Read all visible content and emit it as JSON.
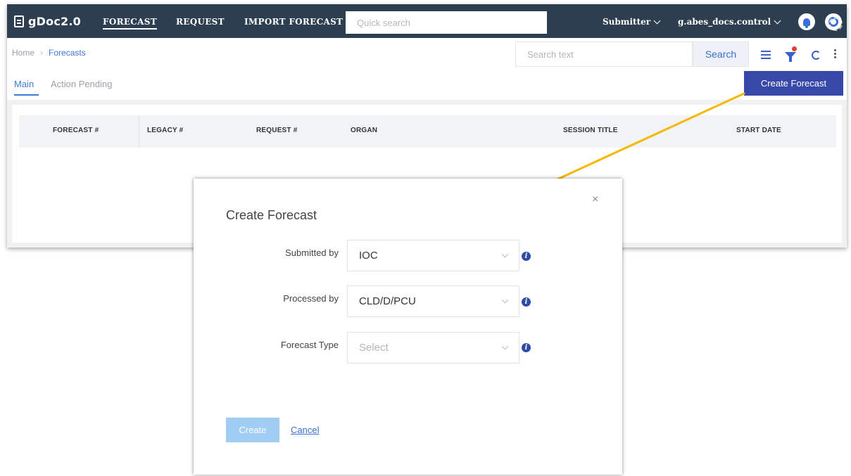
{
  "app": {
    "brand": "gDoc2.0",
    "nav": [
      "FORECAST",
      "REQUEST",
      "IMPORT FORECAST"
    ],
    "quick_search_placeholder": "Quick search",
    "role_dropdown": "Submitter",
    "user_dropdown": "g.abes_docs.control"
  },
  "breadcrumb": {
    "home": "Home",
    "current": "Forecasts"
  },
  "toolbar": {
    "search_placeholder": "Search text",
    "search_label": "Search"
  },
  "tabs": [
    "Main",
    "Action Pending"
  ],
  "create_button_label": "Create Forecast",
  "table": {
    "columns": [
      "FORECAST #",
      "LEGACY #",
      "REQUEST #",
      "ORGAN",
      "SESSION TITLE",
      "START DATE"
    ]
  },
  "modal": {
    "title": "Create Forecast",
    "close": "×",
    "fields": [
      {
        "label": "Submitted by",
        "value": "IOC"
      },
      {
        "label": "Processed by",
        "value": "CLD/D/PCU"
      },
      {
        "label": "Forecast Type",
        "placeholder": "Select"
      }
    ],
    "create_label": "Create",
    "cancel_label": "Cancel"
  },
  "colors": {
    "topbar": "#2c3e50",
    "primary": "#3749a8",
    "link": "#3b7dd8",
    "arrow": "#f5b800",
    "create_disabled": "#9fcdf4"
  }
}
